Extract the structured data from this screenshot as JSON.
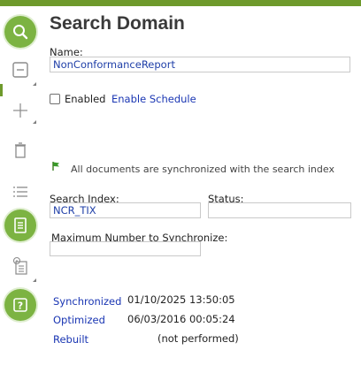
{
  "sidebar": {
    "buttons": [
      {
        "name": "search-icon"
      },
      {
        "name": "save-icon"
      },
      {
        "name": "add-icon"
      },
      {
        "name": "delete-icon"
      },
      {
        "name": "list-icon"
      },
      {
        "name": "notes-icon"
      },
      {
        "name": "info-icon"
      },
      {
        "name": "help-icon"
      }
    ],
    "accent_color": "#7cb342"
  },
  "header": {
    "title": "Search Domain"
  },
  "form": {
    "name_label": "Name:",
    "name_value": "NonConformanceReport",
    "enabled_label": "Enabled",
    "enabled_checked": false,
    "enable_schedule_link": "Enable Schedule",
    "sync_message": "All documents are synchronized with the search index",
    "search_index_label": "Search Index:",
    "search_index_value": "NCR_TIX",
    "status_label": "Status:",
    "status_value": "",
    "max_sync_label": "Maximum Number to Synchronize:",
    "max_sync_value": ""
  },
  "history": [
    {
      "label": "Synchronized",
      "value": "01/10/2025 13:50:05"
    },
    {
      "label": "Optimized",
      "value": "06/03/2016 00:05:24"
    },
    {
      "label": "Rebuilt",
      "value": "(not performed)"
    }
  ]
}
